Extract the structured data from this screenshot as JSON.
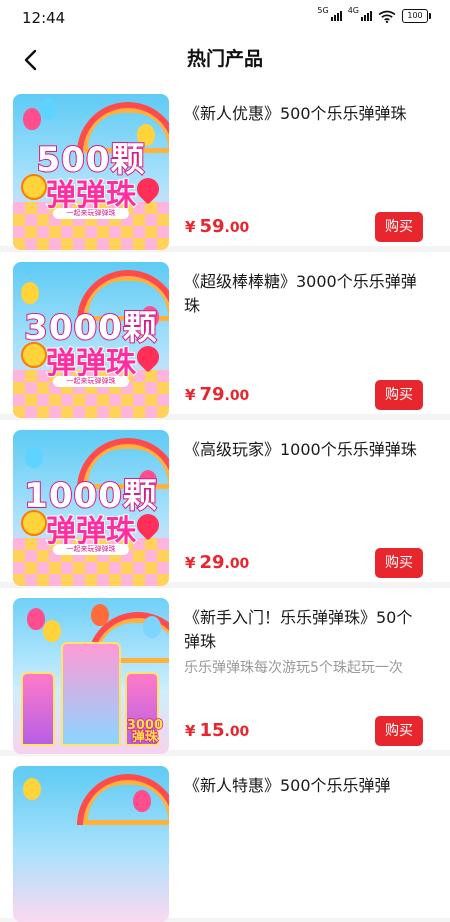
{
  "status_bar": {
    "time": "12:44",
    "net1": "5G",
    "net2": "4G",
    "battery": "100"
  },
  "header": {
    "title": "热门产品"
  },
  "currency": "¥",
  "buy_label": "购买",
  "products": [
    {
      "title": "《新人优惠》500个乐乐弹弹珠",
      "description": "",
      "price_int": "59",
      "price_dec": ".00",
      "image": {
        "line1": "500颗",
        "line2": "弹弹珠",
        "caption": "一起来玩弹弹珠"
      }
    },
    {
      "title": "《超级棒棒糖》3000个乐乐弹弹珠",
      "description": "",
      "price_int": "79",
      "price_dec": ".00",
      "image": {
        "line1": "3000颗",
        "line2": "弹弹珠",
        "caption": "一起来玩弹弹珠"
      }
    },
    {
      "title": "《高级玩家》1000个乐乐弹弹珠",
      "description": "",
      "price_int": "29",
      "price_dec": ".00",
      "image": {
        "line1": "1000颗",
        "line2": "弹弹珠",
        "caption": "一起来玩弹弹珠"
      }
    },
    {
      "title": "《新手入门！乐乐弹弹珠》50个弹珠",
      "description": "乐乐弹弹珠每次游玩5个珠起玩一次",
      "price_int": "15",
      "price_dec": ".00",
      "image": {
        "tag_line1": "3000",
        "tag_line2": "弹珠"
      }
    },
    {
      "title": "《新人特惠》500个乐乐弹弹",
      "description": "",
      "price_int": "",
      "price_dec": "",
      "image": {
        "line1": "",
        "line2": "",
        "caption": ""
      }
    }
  ],
  "colors": {
    "accent": "#e8262d",
    "brand_pink": "#d91a8c",
    "background": "#f4f4f4"
  },
  "icons": {
    "back": "chevron-left-icon",
    "signal": "signal-icon",
    "wifi": "wifi-icon",
    "battery": "battery-icon"
  }
}
